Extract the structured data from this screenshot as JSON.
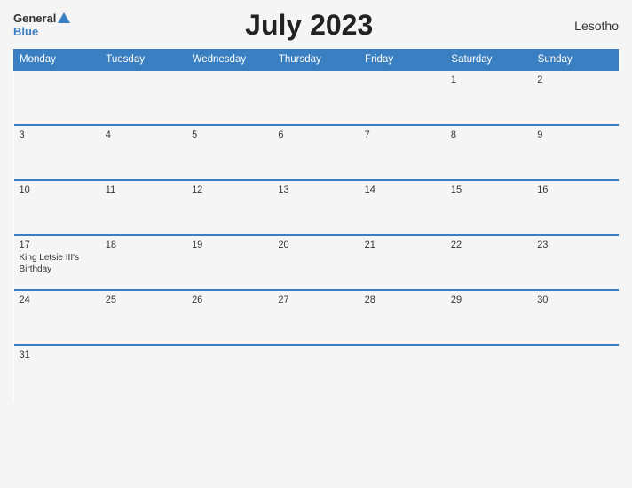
{
  "header": {
    "title": "July 2023",
    "country": "Lesotho",
    "logo_general": "General",
    "logo_blue": "Blue"
  },
  "days_of_week": [
    "Monday",
    "Tuesday",
    "Wednesday",
    "Thursday",
    "Friday",
    "Saturday",
    "Sunday"
  ],
  "weeks": [
    [
      {
        "day": "",
        "event": ""
      },
      {
        "day": "",
        "event": ""
      },
      {
        "day": "",
        "event": ""
      },
      {
        "day": "",
        "event": ""
      },
      {
        "day": "",
        "event": ""
      },
      {
        "day": "1",
        "event": ""
      },
      {
        "day": "2",
        "event": ""
      }
    ],
    [
      {
        "day": "3",
        "event": ""
      },
      {
        "day": "4",
        "event": ""
      },
      {
        "day": "5",
        "event": ""
      },
      {
        "day": "6",
        "event": ""
      },
      {
        "day": "7",
        "event": ""
      },
      {
        "day": "8",
        "event": ""
      },
      {
        "day": "9",
        "event": ""
      }
    ],
    [
      {
        "day": "10",
        "event": ""
      },
      {
        "day": "11",
        "event": ""
      },
      {
        "day": "12",
        "event": ""
      },
      {
        "day": "13",
        "event": ""
      },
      {
        "day": "14",
        "event": ""
      },
      {
        "day": "15",
        "event": ""
      },
      {
        "day": "16",
        "event": ""
      }
    ],
    [
      {
        "day": "17",
        "event": "King Letsie III's Birthday"
      },
      {
        "day": "18",
        "event": ""
      },
      {
        "day": "19",
        "event": ""
      },
      {
        "day": "20",
        "event": ""
      },
      {
        "day": "21",
        "event": ""
      },
      {
        "day": "22",
        "event": ""
      },
      {
        "day": "23",
        "event": ""
      }
    ],
    [
      {
        "day": "24",
        "event": ""
      },
      {
        "day": "25",
        "event": ""
      },
      {
        "day": "26",
        "event": ""
      },
      {
        "day": "27",
        "event": ""
      },
      {
        "day": "28",
        "event": ""
      },
      {
        "day": "29",
        "event": ""
      },
      {
        "day": "30",
        "event": ""
      }
    ],
    [
      {
        "day": "31",
        "event": ""
      },
      {
        "day": "",
        "event": ""
      },
      {
        "day": "",
        "event": ""
      },
      {
        "day": "",
        "event": ""
      },
      {
        "day": "",
        "event": ""
      },
      {
        "day": "",
        "event": ""
      },
      {
        "day": "",
        "event": ""
      }
    ]
  ]
}
